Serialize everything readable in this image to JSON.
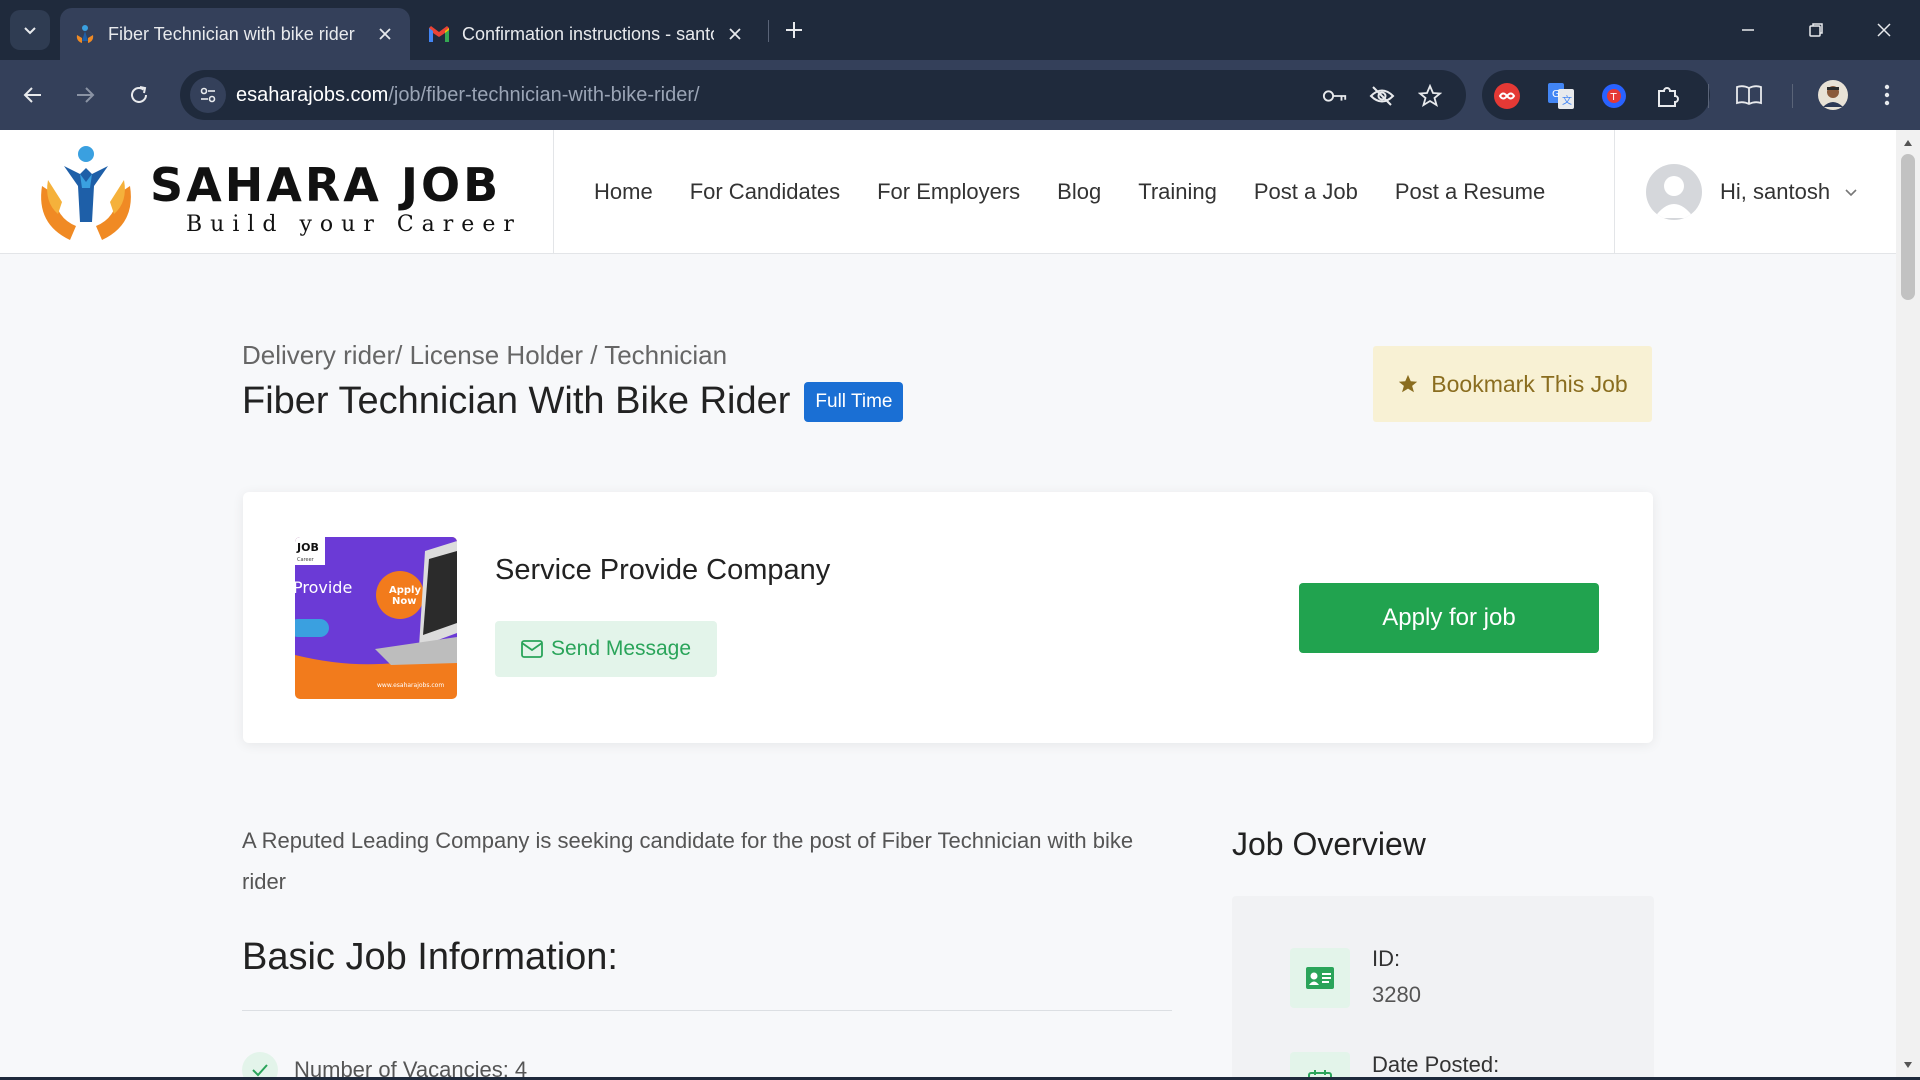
{
  "browser": {
    "tabs": [
      {
        "title": "Fiber Technician with bike rider",
        "favicon": "sahara-job-favicon",
        "active": true
      },
      {
        "title": "Confirmation instructions - santosh",
        "favicon": "gmail-favicon",
        "active": false
      }
    ],
    "url_host": "esaharajobs.com",
    "url_path": "/job/fiber-technician-with-bike-rider/"
  },
  "site": {
    "logo_line1": "SAHARA JOB",
    "logo_line2": "Build your Career",
    "nav": [
      "Home",
      "For Candidates",
      "For Employers",
      "Blog",
      "Training",
      "Post a Job",
      "Post a Resume"
    ],
    "user_greeting": "Hi, santosh"
  },
  "job": {
    "breadcrumb": "Delivery rider/ License Holder / Technician",
    "title": "Fiber Technician With Bike Rider",
    "type_badge": "Full Time",
    "bookmark_label": "Bookmark This Job",
    "company_name": "Service Provide Company",
    "send_message_label": "Send Message",
    "apply_label": "Apply for job",
    "logo_text": {
      "job": "JOB",
      "career": "Career",
      "provide": "Provide",
      "apply_now_1": "Apply",
      "apply_now_2": "Now",
      "website": "www.esaharajobs.com"
    },
    "intro": "A Reputed Leading Company is seeking candidate for the post of Fiber Technician with bike rider",
    "basic_info_heading": "Basic Job Information:",
    "vacancies": "Number of Vacancies: 4"
  },
  "overview": {
    "title": "Job Overview",
    "id_label": "ID:",
    "id_value": "3280",
    "date_label": "Date Posted:"
  },
  "colors": {
    "apply_green": "#21a34f",
    "badge_blue": "#1a6fd4",
    "bookmark_bg": "#f8f1d4",
    "chrome_dark": "#1f2a3c",
    "chrome_toolbar": "#34405a"
  }
}
